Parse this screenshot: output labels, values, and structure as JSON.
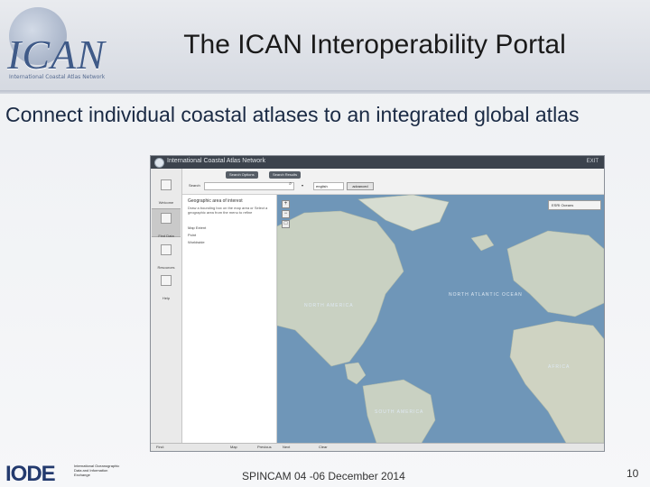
{
  "header": {
    "logo_text": "ICAN",
    "logo_tagline": "International Coastal Atlas Network",
    "title": "The ICAN Interoperability Portal"
  },
  "subtitle": "Connect individual coastal atlases to an integrated global atlas",
  "portal": {
    "app_title": "International Coastal Atlas Network",
    "exit_label": "EXIT",
    "nav": [
      {
        "label": "Welcome",
        "icon": "home-icon"
      },
      {
        "label": "Find Data",
        "icon": "search-data-icon",
        "active": true
      },
      {
        "label": "Resources",
        "icon": "resources-icon"
      },
      {
        "label": "Help",
        "icon": "help-icon"
      }
    ],
    "tabs": [
      "Search Options",
      "Search Results"
    ],
    "search_label": "Search",
    "search_value": "",
    "language": "english",
    "advanced_label": "advanced",
    "panel": {
      "heading": "Geographic area of interest",
      "text": "Draw a bounding box on the map area or Select a geographic area from the menu to refine",
      "options": [
        "Map Extent",
        "Point",
        "Worldwide"
      ]
    },
    "map": {
      "layer_select": "ESRI Oceans",
      "labels": {
        "north_america": "NORTH AMERICA",
        "north_atlantic": "NORTH ATLANTIC OCEAN",
        "africa": "AFRICA",
        "south_america": "SOUTH AMERICA"
      }
    },
    "status": [
      "Find:",
      "Map",
      "Previous",
      "Next",
      "Clear"
    ]
  },
  "footer": {
    "iode_word": "IODE",
    "iode_sub": "International Oceanographic Data and Information Exchange",
    "center": "SPINCAM 04 -06 December 2014",
    "page": "10"
  },
  "colors": {
    "ocean": "#6f96b8",
    "land": "#c9d1c2",
    "title_text": "#1a1a1a",
    "accent": "#3f5a88"
  }
}
